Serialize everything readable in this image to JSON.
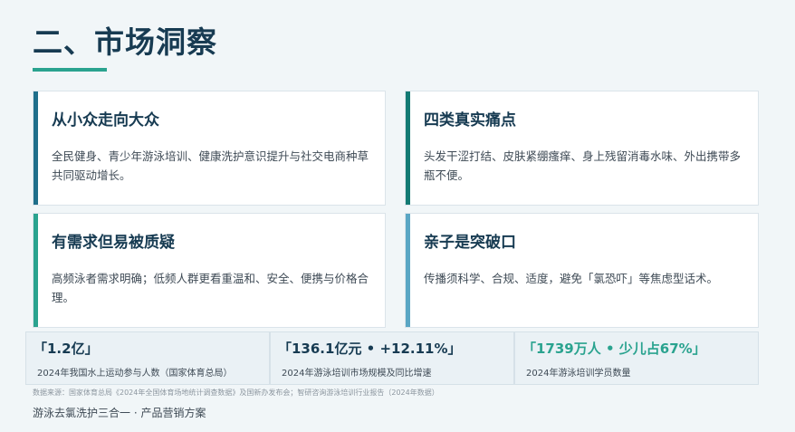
{
  "page": {
    "title": "二、市场洞察"
  },
  "cards": [
    {
      "title": "从小众走向大众",
      "body": "全民健身、青少年游泳培训、健康洗护意识提升与社交电商种草共同驱动增长。",
      "accent": "#1f6f8b"
    },
    {
      "title": "四类真实痛点",
      "body": "头发干涩打结、皮肤紧绷瘙痒、身上残留消毒水味、外出携带多瓶不便。",
      "accent": "#137a73"
    },
    {
      "title": "有需求但易被质疑",
      "body": "高频泳者需求明确；低频人群更看重温和、安全、便携与价格合理。",
      "accent": "#2aa38f"
    },
    {
      "title": "亲子是突破口",
      "body": "传播须科学、合规、适度，避免「氯恐吓」等焦虑型话术。",
      "accent": "#5aa6c4"
    }
  ],
  "stats": [
    {
      "value": "「1.2亿」",
      "label": "2024年我国水上运动参与人数（国家体育总局）",
      "color": "#173b52"
    },
    {
      "value": "「136.1亿元 • +12.11%」",
      "label": "2024年游泳培训市场规模及同比增速",
      "color": "#173b52"
    },
    {
      "value": "「1739万人 • 少儿占67%」",
      "label": "2024年游泳培训学员数量",
      "color": "#2aa38f"
    }
  ],
  "source": "数据来源：国家体育总局《2024年全国体育场地统计调查数据》及国新办发布会；智研咨询游泳培训行业报告（2024年数据）",
  "footer": "游泳去氯洗护三合一 · 产品营销方案"
}
